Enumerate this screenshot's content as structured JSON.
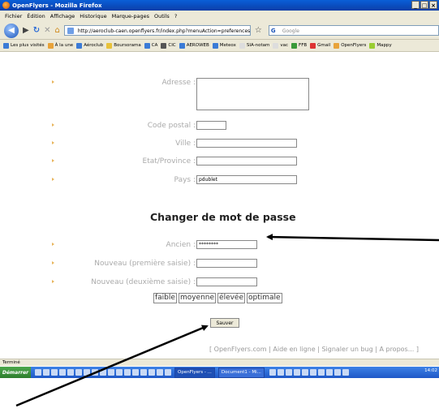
{
  "window": {
    "title": "OpenFlyers - Mozilla Firefox",
    "controls": [
      "_",
      "□",
      "×"
    ]
  },
  "menu": [
    "Fichier",
    "Édition",
    "Affichage",
    "Historique",
    "Marque-pages",
    "Outils",
    "?"
  ],
  "nav": {
    "url": "http://aeroclub-caen.openflyers.fr/index.php?menuAction=preferences",
    "search_placeholder": "Google"
  },
  "bookmarks": [
    "Les plus visités",
    "À la une",
    "Aéroclub",
    "Boursorama",
    "CA",
    "CIC",
    "AEROWEB",
    "Meteox",
    "SIA-notam",
    "vac",
    "FFB",
    "Gmail",
    "OpenFlyers",
    "Mappy"
  ],
  "form": {
    "address_label": "Adresse :",
    "postal_label": "Code postal :",
    "city_label": "Ville :",
    "state_label": "Etat/Province :",
    "country_label": "Pays :",
    "country_value": "pdublet"
  },
  "password": {
    "heading": "Changer de mot de passe",
    "old_label": "Ancien :",
    "old_value": "********",
    "new1_label": "Nouveau (première saisie) :",
    "new2_label": "Nouveau (deuxième saisie) :",
    "strength": [
      "faible",
      "moyenne",
      "élevée",
      "optimale"
    ],
    "save_label": "Sauver"
  },
  "footer": {
    "links_text": "[ OpenFlyers.com  |  Aide en ligne  |  Signaler un bug  |  A propos... ]"
  },
  "status": "Terminé",
  "taskbar": {
    "start": "Démarrer",
    "tasks": [
      "OpenFlyers - ...",
      "Document1 - Mi..."
    ],
    "clock": "14:02"
  }
}
